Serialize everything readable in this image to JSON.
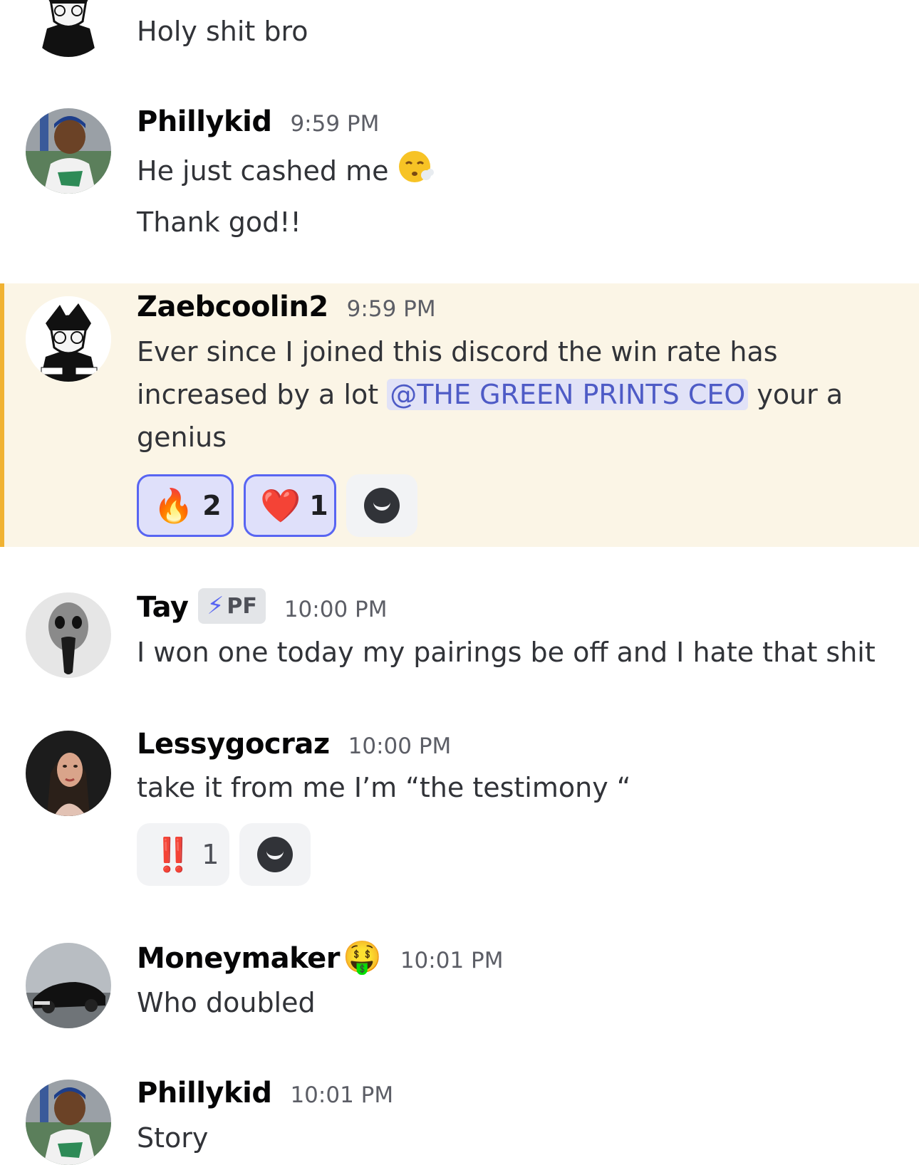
{
  "messages": [
    {
      "id": "m0",
      "text": "Holy shit bro"
    },
    {
      "id": "m1",
      "username": "Phillykid",
      "timestamp": "9:59 PM",
      "lines": [
        "He just cashed me",
        "Thank god!!"
      ],
      "emoji": "😮‍💨"
    },
    {
      "id": "m2",
      "username": "Zaebcoolin2",
      "timestamp": "9:59 PM",
      "text_before": "Ever since I joined this discord the win rate has increased by a lot ",
      "mention": "@THE GREEN PRINTS CEO",
      "text_after": " your a genius",
      "highlighted": true,
      "reactions": [
        {
          "emoji": "🔥",
          "count": "2",
          "me": true
        },
        {
          "emoji": "❤️",
          "count": "1",
          "me": true
        }
      ]
    },
    {
      "id": "m3",
      "username": "Tay",
      "badge": "PF",
      "timestamp": "10:00 PM",
      "text": "I won one today my pairings be off and I hate that shit"
    },
    {
      "id": "m4",
      "username": "Lessygocraz",
      "timestamp": "10:00 PM",
      "text": "take it from me I’m “the testimony “",
      "reactions": [
        {
          "emoji": "‼️",
          "count": "1",
          "me": false
        }
      ]
    },
    {
      "id": "m5",
      "username": "Moneymaker",
      "name_emoji": "🤑",
      "timestamp": "10:01 PM",
      "text": "Who doubled"
    },
    {
      "id": "m6",
      "username": "Phillykid",
      "timestamp": "10:01 PM",
      "text": "Story"
    }
  ],
  "icons": {
    "add_reaction": "smiley-add-icon",
    "badge_icon": "lightning-bolt-icon"
  },
  "colors": {
    "highlight_bg": "#fbf5e6",
    "highlight_bar": "#f0b232",
    "mention_bg": "#e1e2f7",
    "mention_fg": "#4e5bc6",
    "reaction_me_border": "#5865f2"
  }
}
